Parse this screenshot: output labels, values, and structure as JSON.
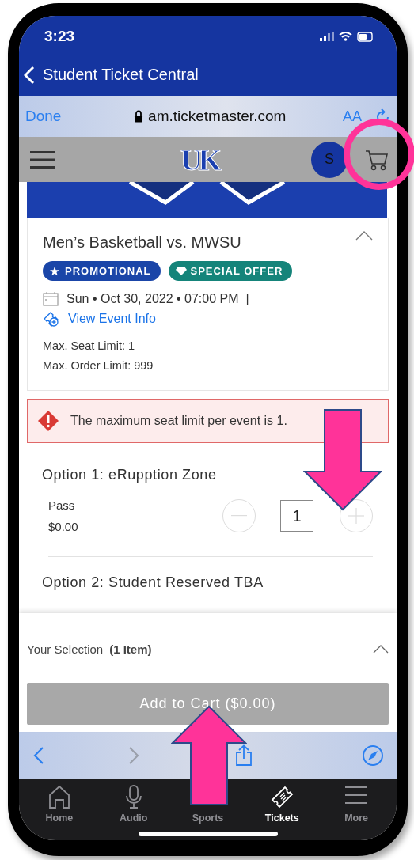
{
  "status_bar": {
    "time": "3:23"
  },
  "nav": {
    "title": "Student Ticket Central"
  },
  "browser": {
    "done": "Done",
    "url": "am.ticketmaster.com",
    "text_size": "AA"
  },
  "site_header": {
    "logo": "UK",
    "avatar": "S"
  },
  "event": {
    "title": "Men’s Basketball vs. MWSU",
    "expanded": true,
    "badges": [
      {
        "label": "PROMOTIONAL",
        "color": "#1a45a8",
        "kind": "star"
      },
      {
        "label": "SPECIAL OFFER",
        "color": "#15847a",
        "kind": "diamond"
      }
    ],
    "date": "Sun • Oct 30, 2022 • 07:00 PM  |",
    "link": "View Event Info",
    "limits": [
      "Max. Seat Limit: 1",
      "Max. Order Limit: 999"
    ]
  },
  "alert": {
    "message": "The maximum seat limit per event is 1."
  },
  "options": [
    {
      "title": "Option 1: eRupption Zone",
      "tickets": [
        {
          "name": "Pass",
          "price": "$0.00",
          "quantity": "1"
        }
      ]
    },
    {
      "title": "Option 2: Student Reserved TBA"
    }
  ],
  "selection": {
    "label": "Your Selection",
    "count": "(1 Item)",
    "expanded": false
  },
  "cart_button": {
    "label": "Add to Cart ($0.00)",
    "disabled": true
  },
  "toolbar": {
    "back_disabled": false,
    "forward_disabled": true
  },
  "tabs": [
    {
      "label": "Home",
      "kind": "home",
      "selected": false
    },
    {
      "label": "Audio",
      "kind": "audio",
      "selected": false
    },
    {
      "label": "Sports",
      "kind": "covered",
      "selected": false
    },
    {
      "label": "Tickets",
      "kind": "tickets",
      "selected": true
    },
    {
      "label": "More",
      "kind": "more",
      "selected": false
    }
  ],
  "annotations": [
    {
      "kind": "circle"
    },
    {
      "kind": "arrow_down"
    },
    {
      "kind": "arrow_up"
    }
  ]
}
